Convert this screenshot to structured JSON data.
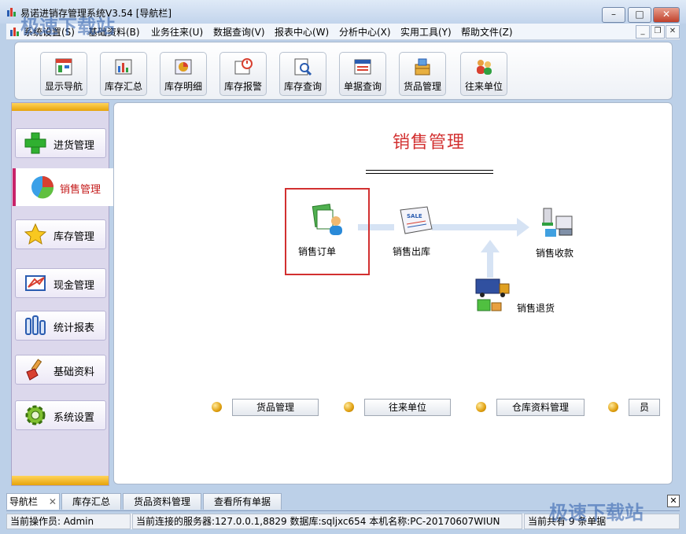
{
  "window": {
    "title": "易诺进销存管理系统V3.54  [导航栏]",
    "minimize_icon": "minimize-icon",
    "maximize_icon": "maximize-icon",
    "close_icon": "close-icon"
  },
  "menu": [
    "系统设置(S)",
    "基础资料(B)",
    "业务往来(U)",
    "数据查询(V)",
    "报表中心(W)",
    "分析中心(X)",
    "实用工具(Y)",
    "帮助文件(Z)"
  ],
  "toolbar": [
    {
      "label": "显示导航",
      "icon": "navigation-icon"
    },
    {
      "label": "库存汇总",
      "icon": "inventory-summary-icon"
    },
    {
      "label": "库存明细",
      "icon": "inventory-detail-icon"
    },
    {
      "label": "库存报警",
      "icon": "inventory-alert-icon"
    },
    {
      "label": "库存查询",
      "icon": "inventory-query-icon"
    },
    {
      "label": "单据查询",
      "icon": "document-query-icon"
    },
    {
      "label": "货品管理",
      "icon": "goods-icon"
    },
    {
      "label": "往来单位",
      "icon": "partners-icon"
    }
  ],
  "navigator": {
    "items": [
      {
        "label": "进货管理",
        "icon": "plus-icon"
      },
      {
        "label": "销售管理",
        "icon": "pie-icon",
        "selected": true
      },
      {
        "label": "库存管理",
        "icon": "star-icon"
      },
      {
        "label": "现金管理",
        "icon": "cash-icon"
      },
      {
        "label": "统计报表",
        "icon": "bar-chart-icon"
      },
      {
        "label": "基础资料",
        "icon": "brush-icon"
      },
      {
        "label": "系统设置",
        "icon": "gear-icon"
      }
    ]
  },
  "main": {
    "title": "销售管理",
    "flow": {
      "order": "销售订单",
      "outbound": "销售出库",
      "receipt": "销售收款",
      "return": "销售退货"
    },
    "links": [
      "货品管理",
      "往来单位",
      "仓库资料管理",
      "员"
    ]
  },
  "tabs": [
    "导航栏",
    "库存汇总",
    "货品资料管理",
    "查看所有单据"
  ],
  "status": {
    "operator": "当前操作员: Admin",
    "connection": "当前连接的服务器:127.0.0.1,8829 数据库:sqljxc654 本机名称:PC-20170607WIUN",
    "total": "当前共有 9 条单据"
  },
  "watermark": "极速下载站"
}
